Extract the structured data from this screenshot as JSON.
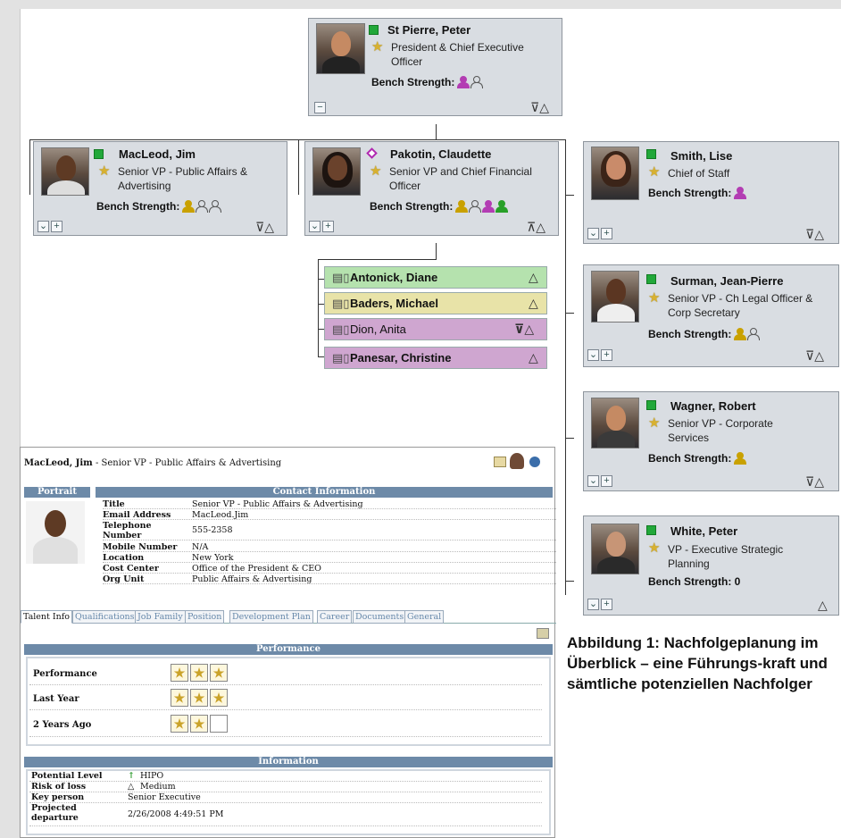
{
  "ceo": {
    "name": "St Pierre, Peter",
    "title_lines": [
      "President & Chief Executive",
      "Officer"
    ],
    "bench_label": "Bench Strength:"
  },
  "direct_reports": [
    {
      "name": "MacLeod, Jim",
      "title_lines": [
        "Senior VP - Public Affairs &",
        "Advertising"
      ],
      "bench_label": "Bench Strength:"
    },
    {
      "name": "Pakotin, Claudette",
      "title_lines": [
        "Senior VP and Chief Financial",
        "Officer"
      ],
      "bench_label": "Bench Strength:"
    },
    {
      "name": "Smith, Lise",
      "title_lines": [
        "Chief of Staff"
      ],
      "bench_label": "Bench Strength:"
    },
    {
      "name": "Surman, Jean-Pierre",
      "title_lines": [
        "Senior VP - Ch Legal Officer &",
        "Corp Secretary"
      ],
      "bench_label": "Bench Strength:"
    },
    {
      "name": "Wagner, Robert",
      "title_lines": [
        "Senior VP - Corporate",
        "Services"
      ],
      "bench_label": "Bench Strength:"
    },
    {
      "name": "White, Peter",
      "title_lines": [
        "VP - Executive Strategic",
        "Planning"
      ],
      "bench_label": "Bench Strength: 0"
    }
  ],
  "successors": [
    {
      "name": "Antonick, Diane",
      "color": "#b5e2ae"
    },
    {
      "name": "Baders, Michael",
      "color": "#e8e3a8"
    },
    {
      "name": "Dion, Anita",
      "color": "#cfa6d0"
    },
    {
      "name": "Panesar, Christine",
      "color": "#cfa6d0"
    }
  ],
  "detail": {
    "header_name": "MacLeod, Jim",
    "header_rest": " - Senior VP - Public Affairs & Advertising",
    "portrait_label": "Portrait",
    "contact_label": "Contact Information",
    "contact_rows": [
      {
        "key": "Title",
        "value": "Senior VP - Public Affairs & Advertising"
      },
      {
        "key": "Email Address",
        "value": "MacLeod.Jim"
      },
      {
        "key": "Telephone Number",
        "value": "555-2358"
      },
      {
        "key": "Mobile Number",
        "value": "N/A"
      },
      {
        "key": "Location",
        "value": "New York"
      },
      {
        "key": "Cost Center",
        "value": "Office of the President & CEO"
      },
      {
        "key": "Org Unit",
        "value": "Public Affairs & Advertising"
      }
    ],
    "tabs": [
      "Talent Info",
      "Qualifications",
      "Job Family",
      "Position",
      "Development Plan",
      "Career",
      "Documents",
      "General"
    ],
    "performance_label": "Performance",
    "performance_rows": [
      {
        "label": "Performance",
        "stars": 3
      },
      {
        "label": "Last Year",
        "stars": 3
      },
      {
        "label": "2 Years Ago",
        "stars": 2
      }
    ],
    "information_label": "Information",
    "information_rows": [
      {
        "key": "Potential Level",
        "value": "HIPO"
      },
      {
        "key": "Risk of loss",
        "value": "Medium"
      },
      {
        "key": "Key person",
        "value": "Senior Executive"
      },
      {
        "key": "Projected departure",
        "value": "2/26/2008 4:49:51 PM"
      }
    ]
  },
  "caption": "Abbildung 1: Nachfolgeplanung im Überblick – eine Führungs-kraft und sämtliche potenziellen Nachfolger"
}
